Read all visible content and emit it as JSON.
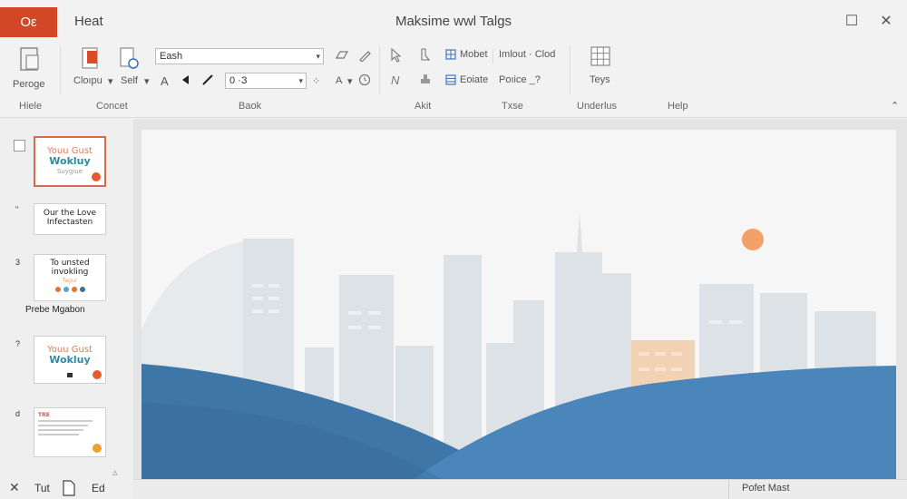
{
  "titlebar": {
    "app_badge": "Oε",
    "tab_home": "Heat",
    "doc_title": "Maksime wwl Talgs",
    "restore_glyph": "☐",
    "close_glyph": "✕"
  },
  "ribbon": {
    "paste_label": "Perоge",
    "clipboard_label": "Cloıpu",
    "self_label": "Self",
    "font_name": "Eash",
    "font_size": "0 ·З",
    "bold_glyph": "A",
    "fx_label": "Α",
    "arrange_label": "Mobet",
    "arrange_label2": "Eoiate",
    "insert_label": "Imlout · Clod",
    "picture_label": "Poıice _?",
    "table_label": "Teys",
    "groups": {
      "g1": "Hiele",
      "g2": "Concet",
      "g3": "Baok",
      "g4": "Akit",
      "g5": "Txse",
      "g6": "Underlus",
      "g7": "Help"
    }
  },
  "thumbnails": [
    {
      "num": "",
      "line1": "Youu Gust",
      "line2": "Wokluy",
      "line3": "Suygıue"
    },
    {
      "num": "\"",
      "line1": "Our the Love",
      "line2": "Infectasten"
    },
    {
      "num": "3",
      "line1": "To unsted",
      "line2": "invokling",
      "line3": "Tagur"
    },
    {
      "num": "?",
      "line1": "Youu Gust",
      "line2": "Wokluy"
    },
    {
      "num": "d",
      "line1": "TRE"
    }
  ],
  "thumb_caption": "Prebe Mgabon",
  "statusbar": {
    "left_a": "Tut",
    "left_b": "Ed",
    "right": "Pofet Mast"
  },
  "colors": {
    "accent": "#d24726",
    "sun": "#f4a06a",
    "wave": "#3f7cad"
  }
}
